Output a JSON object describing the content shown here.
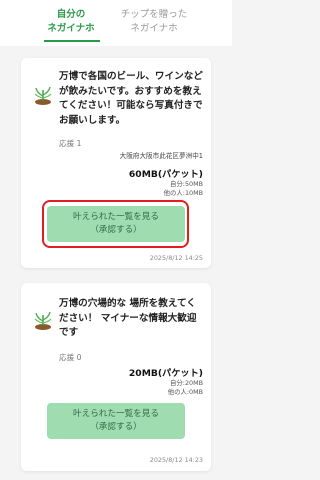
{
  "tabs": [
    {
      "label_line1": "自分の",
      "label_line2": "ネガイナホ",
      "active": true
    },
    {
      "label_line1": "チップを贈った",
      "label_line2": "ネガイナホ",
      "active": false
    }
  ],
  "colors": {
    "accent": "#2a9a4a",
    "button": "#9fdcb0",
    "button_text": "#2f6a45",
    "highlight": "#e02020"
  },
  "posts": [
    {
      "message": "万博で各国のビール、ワインなどが飲みたいです。おすすめを教えてください！可能なら写真付きでお願いします。",
      "applicants": "応援 1",
      "location": "大阪府大阪市此花区夢洲中1",
      "amount": "60MB(パケット)",
      "own": "自分:50MB",
      "others": "他の人:10MB",
      "button_line1": "叶えられた一覧を見る",
      "button_line2": "（承認する）",
      "timestamp": "2025/8/12 14:25"
    },
    {
      "message": "万博の穴場的な 場所を教えてください！ マイナーな情報大歓迎です",
      "applicants": "応援 0",
      "amount": "20MB(パケット)",
      "own": "自分:20MB",
      "others": "他の人:0MB",
      "button_line1": "叶えられた一覧を見る",
      "button_line2": "（承認する）",
      "timestamp": "2025/8/12 14:23"
    }
  ]
}
